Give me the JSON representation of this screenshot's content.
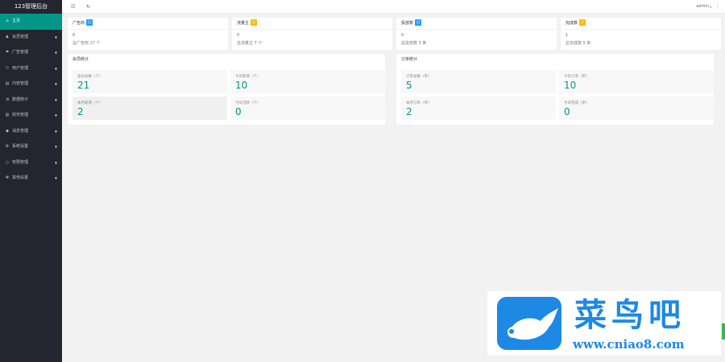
{
  "sidebar": {
    "title": "123管理后台",
    "items": [
      {
        "label": "主页",
        "icon": "home-icon",
        "glyph": "⌂",
        "active": true,
        "has_children": false
      },
      {
        "label": "会员管理",
        "icon": "users-icon",
        "glyph": "♟",
        "active": false,
        "has_children": true
      },
      {
        "label": "广告管理",
        "icon": "flag-icon",
        "glyph": "⚑",
        "active": false,
        "has_children": true
      },
      {
        "label": "用户管理",
        "icon": "user-icon",
        "glyph": "☉",
        "active": false,
        "has_children": true
      },
      {
        "label": "内容管理",
        "icon": "document-icon",
        "glyph": "▤",
        "active": false,
        "has_children": true
      },
      {
        "label": "数据统计",
        "icon": "chart-icon",
        "glyph": "◔",
        "active": false,
        "has_children": true
      },
      {
        "label": "财务管理",
        "icon": "wallet-icon",
        "glyph": "▥",
        "active": false,
        "has_children": true
      },
      {
        "label": "消息管理",
        "icon": "message-icon",
        "glyph": "◆",
        "active": false,
        "has_children": true
      },
      {
        "label": "系统设置",
        "icon": "gear-icon",
        "glyph": "⚙",
        "active": false,
        "has_children": true
      },
      {
        "label": "权限管理",
        "icon": "shield-icon",
        "glyph": "◇",
        "active": false,
        "has_children": true
      },
      {
        "label": "其他设置",
        "icon": "settings-icon",
        "glyph": "✻",
        "active": false,
        "has_children": true
      }
    ]
  },
  "header": {
    "menu_icon": "menu-icon",
    "refresh_icon": "refresh-icon",
    "user": "admin",
    "more_icon": "more-icon"
  },
  "stats": [
    {
      "title": "广告商",
      "badge": "日",
      "badge_color": "#1e9fff",
      "value": "0",
      "sub": "总广告商 17 个"
    },
    {
      "title": "流量主",
      "badge": "日",
      "badge_color": "#ffb800",
      "value": "0",
      "sub": "总流量主 7 个"
    },
    {
      "title": "投放数",
      "badge": "日",
      "badge_color": "#1e9fff",
      "value": "0",
      "sub": "总投放数 5 条"
    },
    {
      "title": "完成数",
      "badge": "日",
      "badge_color": "#ffb800",
      "value": "1",
      "sub": "总完成数 5 条"
    }
  ],
  "panels": [
    {
      "title": "会员统计",
      "tiles": [
        {
          "label": "会员总数（个）",
          "value": "21"
        },
        {
          "label": "今日新增（个）",
          "value": "10"
        },
        {
          "label": "本月新增（个）",
          "value": "2"
        },
        {
          "label": "今日活跃（个）",
          "value": "0"
        }
      ]
    },
    {
      "title": "订单统计",
      "tiles": [
        {
          "label": "订单总数（单）",
          "value": "5"
        },
        {
          "label": "今日订单（单）",
          "value": "10"
        },
        {
          "label": "本月订单（单）",
          "value": "2"
        },
        {
          "label": "今日完成（单）",
          "value": "0"
        }
      ]
    }
  ],
  "watermark": {
    "text": "菜鸟吧",
    "url": "www.cniao8.com",
    "color": "#1e88e5"
  },
  "colors": {
    "accent": "#009688",
    "sidebar_bg": "#23262e",
    "badge_blue": "#1e9fff",
    "badge_yellow": "#ffb800"
  }
}
